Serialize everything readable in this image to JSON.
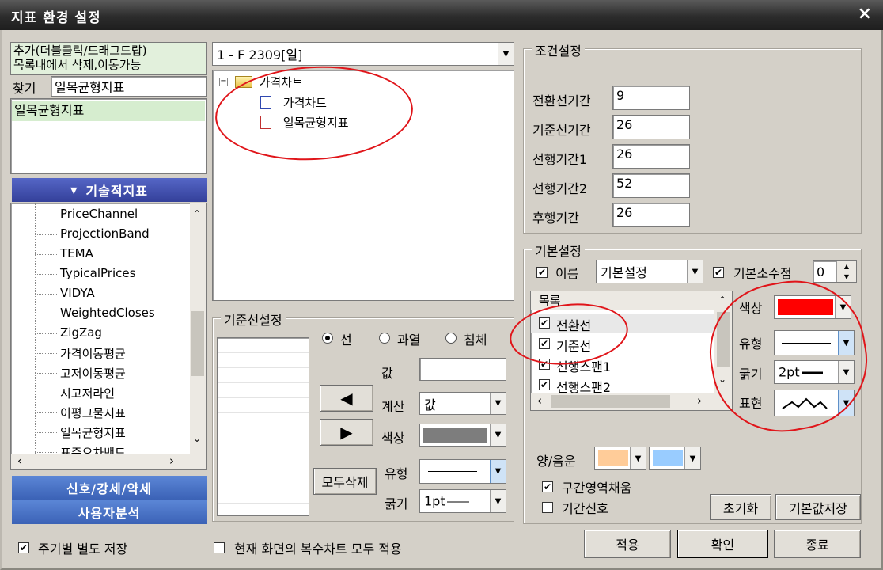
{
  "window": {
    "title": "지표 환경 설정",
    "close": "×"
  },
  "left": {
    "hint_line1": "추가(더블클릭/드래그드랍)",
    "hint_line2": "목록내에서 삭제,이동가능",
    "search_label": "찾기",
    "search_value": "일목균형지표",
    "selected": [
      "일목균형지표"
    ],
    "tech_header": "기술적지표",
    "tech_items": [
      "PriceChannel",
      "ProjectionBand",
      "TEMA",
      "TypicalPrices",
      "VIDYA",
      "WeightedCloses",
      "ZigZag",
      "가격이동평균",
      "고저이동평균",
      "시고저라인",
      "이평그물지표",
      "일목균형지표",
      "표준오차밴드"
    ],
    "signal_btn": "신호/강세/약세",
    "user_btn": "사용자분석"
  },
  "middle": {
    "chart_combo": "1 - F 2309[일]",
    "tree_root": "가격차트",
    "tree_children": [
      "가격차트",
      "일목균형지표"
    ],
    "base_group": "기준선설정",
    "radio_line": "선",
    "radio_over": "과열",
    "radio_sink": "침체",
    "value_label": "값",
    "calc_label": "계산",
    "calc_value": "값",
    "color_label": "색상",
    "type_label": "유형",
    "width_label": "굵기",
    "width_value": "1pt",
    "delete_all": "모두삭제",
    "left_arrow": "◀",
    "right_arrow": "▶"
  },
  "conditions": {
    "group": "조건설정",
    "rows": [
      {
        "label": "전환선기간",
        "value": "9"
      },
      {
        "label": "기준선기간",
        "value": "26"
      },
      {
        "label": "선행기간1",
        "value": "26"
      },
      {
        "label": "선행기간2",
        "value": "52"
      },
      {
        "label": "후행기간",
        "value": "26"
      }
    ]
  },
  "basic": {
    "group": "기본설정",
    "name_label": "이름",
    "name_combo": "기본설정",
    "decimal_label": "기본소수점",
    "decimal_value": "0",
    "list_header": "목록",
    "list_items": [
      "전환선",
      "기준선",
      "선행스팬1",
      "선행스팬2"
    ],
    "color_label": "색상",
    "type_label": "유형",
    "width_label": "굵기",
    "width_value": "2pt",
    "expr_label": "표현",
    "line_color": "#ff0000",
    "yangeum_label": "양/음운",
    "color_yang": "#ffcc99",
    "color_eum": "#99ccff",
    "fill_label": "구간영역채움",
    "signal_label": "기간신호",
    "reset_btn": "초기화",
    "save_default_btn": "기본값저장"
  },
  "footer": {
    "period_save": "주기별 별도 저장",
    "apply_all": "현재 화면의 복수차트 모두 적용",
    "apply": "적용",
    "ok": "확인",
    "close": "종료"
  },
  "colors": {
    "accent_nav": "#3f4fb0",
    "signal_nav": "#4a72c4",
    "gray_swatch": "#7d7d7d"
  }
}
